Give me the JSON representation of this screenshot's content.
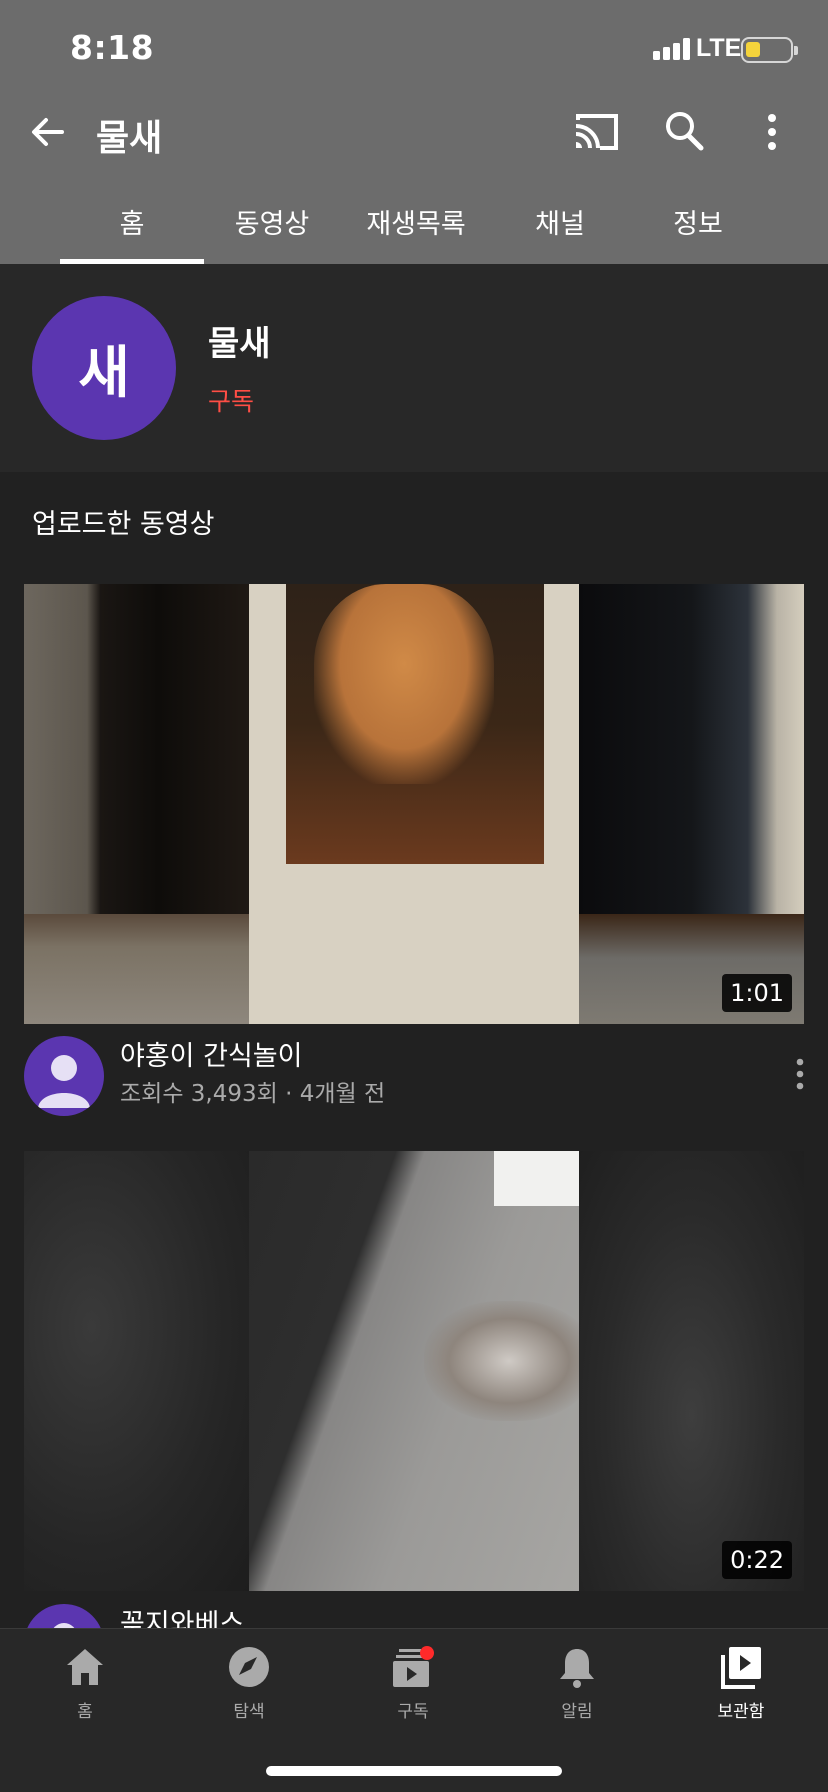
{
  "status": {
    "time": "8:18",
    "network": "LTE"
  },
  "appbar": {
    "title": "물새"
  },
  "tabs": [
    {
      "label": "홈",
      "active": true
    },
    {
      "label": "동영상",
      "active": false
    },
    {
      "label": "재생목록",
      "active": false
    },
    {
      "label": "채널",
      "active": false
    },
    {
      "label": "정보",
      "active": false
    }
  ],
  "channel": {
    "avatar_letter": "새",
    "name": "물새",
    "subscribe_label": "구독"
  },
  "section": {
    "title": "업로드한 동영상"
  },
  "videos": [
    {
      "title": "야홍이 간식놀이",
      "views_age": "조회수 3,493회 · 4개월 전",
      "duration": "1:01"
    },
    {
      "title": "꽂지와베스",
      "views_age": "",
      "duration": "0:22"
    }
  ],
  "bottom_nav": [
    {
      "label": "홈",
      "icon": "home-icon"
    },
    {
      "label": "탐색",
      "icon": "explore-icon"
    },
    {
      "label": "구독",
      "icon": "subscriptions-icon",
      "badge": true
    },
    {
      "label": "알림",
      "icon": "bell-icon"
    },
    {
      "label": "보관함",
      "icon": "library-icon",
      "active": true
    }
  ],
  "colors": {
    "topbar": "#6c6c6c",
    "background": "#212121",
    "avatar": "#5b36b0",
    "subscribe": "#ff4e45",
    "battery": "#f4d33b",
    "badge": "#ff0000"
  }
}
